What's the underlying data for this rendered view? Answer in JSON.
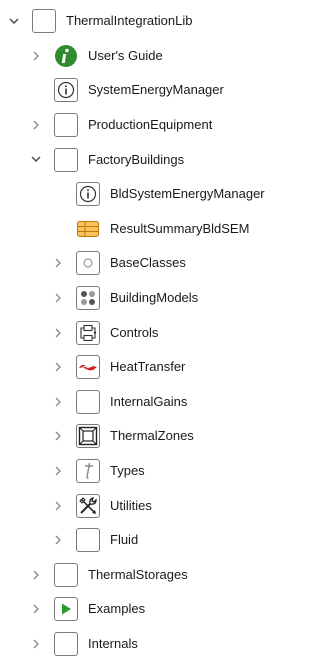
{
  "tree": [
    {
      "label": "ThermalIntegrationLib",
      "icon": "package-blank-icon",
      "expanded": true
    },
    {
      "label": "User's Guide",
      "icon": "info-circle-green-icon",
      "expanded": false
    },
    {
      "label": "SystemEnergyManager",
      "icon": "info-boxed-icon",
      "expanded": null
    },
    {
      "label": "ProductionEquipment",
      "icon": "package-blank-icon",
      "expanded": false
    },
    {
      "label": "FactoryBuildings",
      "icon": "package-blank-icon",
      "expanded": true
    },
    {
      "label": "BldSystemEnergyManager",
      "icon": "info-boxed-icon",
      "expanded": null
    },
    {
      "label": "ResultSummaryBldSEM",
      "icon": "table-orange-icon",
      "expanded": null
    },
    {
      "label": "BaseClasses",
      "icon": "base-classes-icon",
      "expanded": false
    },
    {
      "label": "BuildingModels",
      "icon": "building-models-icon",
      "expanded": false
    },
    {
      "label": "Controls",
      "icon": "controls-icon",
      "expanded": false
    },
    {
      "label": "HeatTransfer",
      "icon": "heat-transfer-icon",
      "expanded": false
    },
    {
      "label": "InternalGains",
      "icon": "package-blank-icon",
      "expanded": false
    },
    {
      "label": "ThermalZones",
      "icon": "thermal-zones-icon",
      "expanded": false
    },
    {
      "label": "Types",
      "icon": "types-icon",
      "expanded": false
    },
    {
      "label": "Utilities",
      "icon": "utilities-icon",
      "expanded": false
    },
    {
      "label": "Fluid",
      "icon": "package-blank-icon",
      "expanded": false
    },
    {
      "label": "ThermalStorages",
      "icon": "package-blank-icon",
      "expanded": false
    },
    {
      "label": "Examples",
      "icon": "examples-play-icon",
      "expanded": false
    },
    {
      "label": "Internals",
      "icon": "package-blank-icon",
      "expanded": false
    }
  ]
}
